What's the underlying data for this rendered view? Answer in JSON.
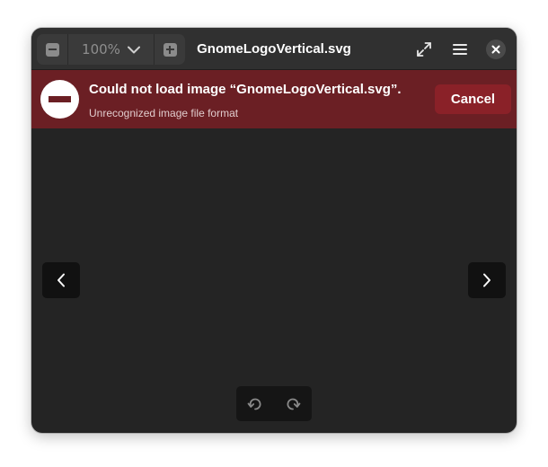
{
  "window": {
    "title": "GnomeLogoVertical.svg"
  },
  "header": {
    "zoom_level": "100%",
    "icons": {
      "zoom_out": "zoom-out-icon",
      "zoom_menu": "chevron-down-icon",
      "zoom_in": "zoom-in-icon",
      "fullscreen": "fullscreen-icon",
      "menu": "hamburger-menu-icon",
      "close": "close-icon"
    }
  },
  "error_banner": {
    "title": "Could not load image “GnomeLogoVertical.svg”.",
    "subtitle": "Unrecognized image file format",
    "cancel_label": "Cancel",
    "icon": "error-icon"
  },
  "navigation": {
    "previous_icon": "chevron-left-icon",
    "next_icon": "chevron-right-icon"
  },
  "rotate_controls": {
    "rotate_left_icon": "rotate-left-icon",
    "rotate_right_icon": "rotate-right-icon"
  },
  "colors": {
    "window_background": "#242424",
    "headerbar": "#303030",
    "error_banner": "#6b1f24",
    "cancel_button": "#8a2128",
    "overlay_buttons": "#111111"
  }
}
